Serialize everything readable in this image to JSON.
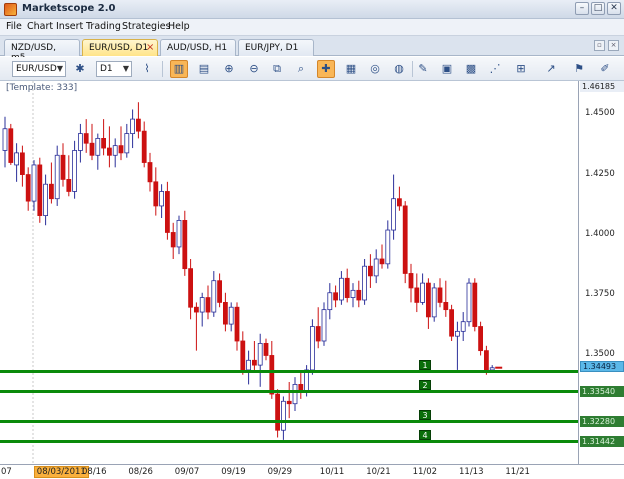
{
  "app": {
    "title": "Marketscope 2.0",
    "window_controls": [
      "minimize-icon",
      "restore-icon",
      "close-icon"
    ]
  },
  "menu": {
    "items": [
      "File",
      "Chart",
      "Insert",
      "Trading",
      "Strategies",
      "Help"
    ]
  },
  "tabs": [
    {
      "label": "NZD/USD, m5",
      "active": false
    },
    {
      "label": "EUR/USD, D1",
      "active": true
    },
    {
      "label": "AUD/USD, H1",
      "active": false
    },
    {
      "label": "EUR/JPY, D1",
      "active": false
    }
  ],
  "toolbar": {
    "symbol": "EUR/USD",
    "timeframe": "D1",
    "icons": [
      "chart-type-icon",
      "tick-chart-icon",
      "zoom-in-icon",
      "zoom-out-icon",
      "zoom-fit-icon",
      "crosshair-icon",
      "properties-icon",
      "indicator-icon",
      "globe-icon",
      "pencil-icon",
      "image-icon",
      "grid-icon",
      "fibonacci-icon",
      "add-line-icon",
      "trend-icon",
      "marker-icon"
    ]
  },
  "chart": {
    "template_label": "[Template: 333]",
    "current_price": "1.34493",
    "top_price": "1.46185",
    "colors": {
      "up": "#2a2f9a",
      "down": "#cc1111",
      "level": "#0a8a0a"
    },
    "levels": [
      {
        "label": "1",
        "price": 1.3436,
        "price_text": ""
      },
      {
        "label": "2",
        "price": 1.3354,
        "price_text": "1.33540"
      },
      {
        "label": "3",
        "price": 1.3228,
        "price_text": "1.32280"
      },
      {
        "label": "4",
        "price": 1.3144,
        "price_text": "1.31442"
      }
    ]
  },
  "chart_data": {
    "type": "candlestick",
    "title": "",
    "xlabel": "",
    "ylabel": "",
    "ylim": [
      1.305,
      1.4638
    ],
    "y_ticks": [
      "1.4500",
      "1.4250",
      "1.4000",
      "1.3750",
      "1.3500"
    ],
    "x_ticks": [
      "07",
      "08/03/2011",
      "08/16",
      "08/26",
      "09/07",
      "09/19",
      "09/29",
      "10/11",
      "10/21",
      "11/02",
      "11/13",
      "11/21"
    ],
    "x_tick_index": [
      0,
      6,
      15,
      23,
      31,
      39,
      47,
      56,
      64,
      72,
      80,
      88
    ],
    "highlight_x_tick": "08/03/2011",
    "candles": [
      {
        "o": 1.435,
        "h": 1.449,
        "l": 1.428,
        "c": 1.444
      },
      {
        "o": 1.444,
        "h": 1.446,
        "l": 1.429,
        "c": 1.43
      },
      {
        "o": 1.429,
        "h": 1.438,
        "l": 1.422,
        "c": 1.434
      },
      {
        "o": 1.434,
        "h": 1.437,
        "l": 1.42,
        "c": 1.425
      },
      {
        "o": 1.425,
        "h": 1.428,
        "l": 1.41,
        "c": 1.414
      },
      {
        "o": 1.414,
        "h": 1.431,
        "l": 1.41,
        "c": 1.429
      },
      {
        "o": 1.429,
        "h": 1.432,
        "l": 1.405,
        "c": 1.408
      },
      {
        "o": 1.408,
        "h": 1.425,
        "l": 1.404,
        "c": 1.421
      },
      {
        "o": 1.421,
        "h": 1.43,
        "l": 1.413,
        "c": 1.415
      },
      {
        "o": 1.415,
        "h": 1.437,
        "l": 1.412,
        "c": 1.433
      },
      {
        "o": 1.433,
        "h": 1.438,
        "l": 1.42,
        "c": 1.423
      },
      {
        "o": 1.423,
        "h": 1.433,
        "l": 1.416,
        "c": 1.418
      },
      {
        "o": 1.418,
        "h": 1.439,
        "l": 1.415,
        "c": 1.435
      },
      {
        "o": 1.435,
        "h": 1.446,
        "l": 1.43,
        "c": 1.442
      },
      {
        "o": 1.442,
        "h": 1.448,
        "l": 1.434,
        "c": 1.438
      },
      {
        "o": 1.438,
        "h": 1.446,
        "l": 1.431,
        "c": 1.433
      },
      {
        "o": 1.433,
        "h": 1.442,
        "l": 1.427,
        "c": 1.44
      },
      {
        "o": 1.44,
        "h": 1.448,
        "l": 1.433,
        "c": 1.436
      },
      {
        "o": 1.436,
        "h": 1.445,
        "l": 1.428,
        "c": 1.433
      },
      {
        "o": 1.433,
        "h": 1.44,
        "l": 1.428,
        "c": 1.437
      },
      {
        "o": 1.437,
        "h": 1.445,
        "l": 1.431,
        "c": 1.434
      },
      {
        "o": 1.434,
        "h": 1.446,
        "l": 1.432,
        "c": 1.442
      },
      {
        "o": 1.442,
        "h": 1.452,
        "l": 1.436,
        "c": 1.448
      },
      {
        "o": 1.448,
        "h": 1.455,
        "l": 1.44,
        "c": 1.443
      },
      {
        "o": 1.443,
        "h": 1.447,
        "l": 1.428,
        "c": 1.43
      },
      {
        "o": 1.43,
        "h": 1.434,
        "l": 1.418,
        "c": 1.422
      },
      {
        "o": 1.422,
        "h": 1.428,
        "l": 1.408,
        "c": 1.412
      },
      {
        "o": 1.412,
        "h": 1.421,
        "l": 1.407,
        "c": 1.418
      },
      {
        "o": 1.418,
        "h": 1.422,
        "l": 1.398,
        "c": 1.401
      },
      {
        "o": 1.401,
        "h": 1.405,
        "l": 1.39,
        "c": 1.395
      },
      {
        "o": 1.395,
        "h": 1.408,
        "l": 1.392,
        "c": 1.406
      },
      {
        "o": 1.406,
        "h": 1.41,
        "l": 1.383,
        "c": 1.386
      },
      {
        "o": 1.386,
        "h": 1.39,
        "l": 1.365,
        "c": 1.37
      },
      {
        "o": 1.37,
        "h": 1.372,
        "l": 1.352,
        "c": 1.368
      },
      {
        "o": 1.368,
        "h": 1.376,
        "l": 1.362,
        "c": 1.374
      },
      {
        "o": 1.374,
        "h": 1.379,
        "l": 1.365,
        "c": 1.368
      },
      {
        "o": 1.368,
        "h": 1.385,
        "l": 1.366,
        "c": 1.381
      },
      {
        "o": 1.381,
        "h": 1.384,
        "l": 1.37,
        "c": 1.372
      },
      {
        "o": 1.372,
        "h": 1.376,
        "l": 1.36,
        "c": 1.363
      },
      {
        "o": 1.363,
        "h": 1.372,
        "l": 1.36,
        "c": 1.37
      },
      {
        "o": 1.37,
        "h": 1.372,
        "l": 1.352,
        "c": 1.356
      },
      {
        "o": 1.356,
        "h": 1.36,
        "l": 1.342,
        "c": 1.344
      },
      {
        "o": 1.344,
        "h": 1.352,
        "l": 1.338,
        "c": 1.348
      },
      {
        "o": 1.348,
        "h": 1.356,
        "l": 1.344,
        "c": 1.346
      },
      {
        "o": 1.346,
        "h": 1.359,
        "l": 1.337,
        "c": 1.355
      },
      {
        "o": 1.355,
        "h": 1.357,
        "l": 1.348,
        "c": 1.35
      },
      {
        "o": 1.35,
        "h": 1.356,
        "l": 1.332,
        "c": 1.334
      },
      {
        "o": 1.334,
        "h": 1.336,
        "l": 1.316,
        "c": 1.319
      },
      {
        "o": 1.319,
        "h": 1.333,
        "l": 1.315,
        "c": 1.331
      },
      {
        "o": 1.331,
        "h": 1.339,
        "l": 1.324,
        "c": 1.33
      },
      {
        "o": 1.33,
        "h": 1.341,
        "l": 1.327,
        "c": 1.338
      },
      {
        "o": 1.338,
        "h": 1.343,
        "l": 1.332,
        "c": 1.335
      },
      {
        "o": 1.335,
        "h": 1.346,
        "l": 1.333,
        "c": 1.344
      },
      {
        "o": 1.344,
        "h": 1.365,
        "l": 1.342,
        "c": 1.362
      },
      {
        "o": 1.362,
        "h": 1.37,
        "l": 1.353,
        "c": 1.356
      },
      {
        "o": 1.356,
        "h": 1.372,
        "l": 1.354,
        "c": 1.369
      },
      {
        "o": 1.369,
        "h": 1.38,
        "l": 1.365,
        "c": 1.376
      },
      {
        "o": 1.376,
        "h": 1.379,
        "l": 1.37,
        "c": 1.373
      },
      {
        "o": 1.373,
        "h": 1.385,
        "l": 1.371,
        "c": 1.382
      },
      {
        "o": 1.382,
        "h": 1.386,
        "l": 1.372,
        "c": 1.374
      },
      {
        "o": 1.374,
        "h": 1.38,
        "l": 1.37,
        "c": 1.377
      },
      {
        "o": 1.377,
        "h": 1.381,
        "l": 1.37,
        "c": 1.373
      },
      {
        "o": 1.373,
        "h": 1.39,
        "l": 1.371,
        "c": 1.387
      },
      {
        "o": 1.387,
        "h": 1.392,
        "l": 1.378,
        "c": 1.383
      },
      {
        "o": 1.383,
        "h": 1.394,
        "l": 1.38,
        "c": 1.39
      },
      {
        "o": 1.39,
        "h": 1.396,
        "l": 1.386,
        "c": 1.388
      },
      {
        "o": 1.388,
        "h": 1.406,
        "l": 1.386,
        "c": 1.402
      },
      {
        "o": 1.402,
        "h": 1.425,
        "l": 1.398,
        "c": 1.415
      },
      {
        "o": 1.415,
        "h": 1.42,
        "l": 1.41,
        "c": 1.412
      },
      {
        "o": 1.412,
        "h": 1.414,
        "l": 1.38,
        "c": 1.384
      },
      {
        "o": 1.384,
        "h": 1.388,
        "l": 1.372,
        "c": 1.378
      },
      {
        "o": 1.378,
        "h": 1.384,
        "l": 1.368,
        "c": 1.372
      },
      {
        "o": 1.372,
        "h": 1.384,
        "l": 1.371,
        "c": 1.38
      },
      {
        "o": 1.38,
        "h": 1.382,
        "l": 1.361,
        "c": 1.366
      },
      {
        "o": 1.366,
        "h": 1.38,
        "l": 1.364,
        "c": 1.378
      },
      {
        "o": 1.378,
        "h": 1.382,
        "l": 1.37,
        "c": 1.372
      },
      {
        "o": 1.372,
        "h": 1.381,
        "l": 1.366,
        "c": 1.369
      },
      {
        "o": 1.369,
        "h": 1.371,
        "l": 1.356,
        "c": 1.358
      },
      {
        "o": 1.358,
        "h": 1.364,
        "l": 1.344,
        "c": 1.36
      },
      {
        "o": 1.36,
        "h": 1.368,
        "l": 1.356,
        "c": 1.364
      },
      {
        "o": 1.364,
        "h": 1.382,
        "l": 1.362,
        "c": 1.38
      },
      {
        "o": 1.38,
        "h": 1.382,
        "l": 1.36,
        "c": 1.362
      },
      {
        "o": 1.362,
        "h": 1.364,
        "l": 1.35,
        "c": 1.352
      },
      {
        "o": 1.352,
        "h": 1.354,
        "l": 1.342,
        "c": 1.344
      },
      {
        "o": 1.344,
        "h": 1.346,
        "l": 1.343,
        "c": 1.3449
      }
    ]
  }
}
